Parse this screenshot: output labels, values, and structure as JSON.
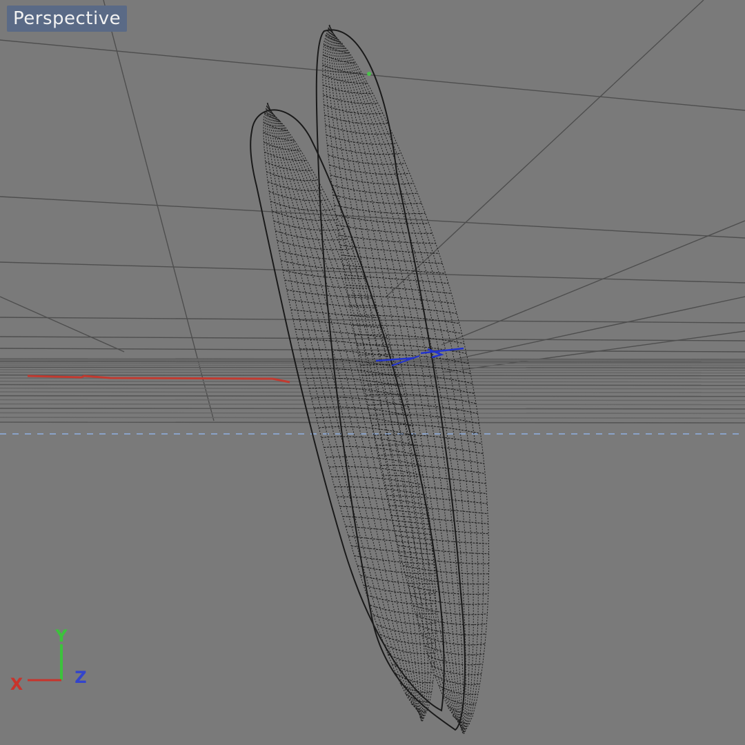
{
  "viewport": {
    "view_label": "Perspective",
    "background_color": "#7a7a7a",
    "label_background_color": "#5a6a86"
  },
  "axes_gizmo": {
    "x_label": "X",
    "y_label": "Y",
    "z_label": "Z",
    "x_color": "#c8342c",
    "y_color": "#3cc23c",
    "z_color": "#3344cc"
  },
  "mesh": {
    "display_mode": "wireframe",
    "wire_color": "#1e1e1e"
  }
}
